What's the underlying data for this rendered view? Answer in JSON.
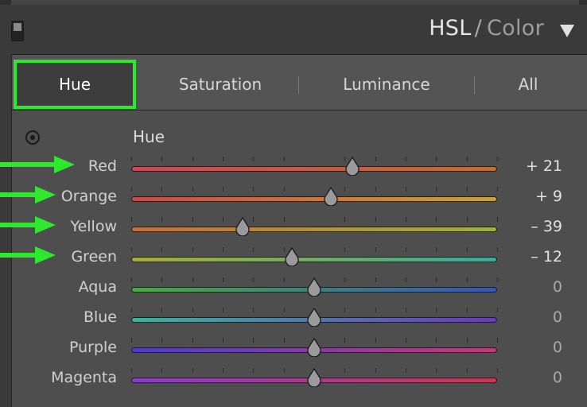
{
  "header": {
    "title_primary": "HSL",
    "title_separator": "/",
    "title_secondary": "Color"
  },
  "tabs": [
    {
      "label": "Hue",
      "active": true
    },
    {
      "label": "Saturation",
      "active": false
    },
    {
      "label": "Luminance",
      "active": false
    },
    {
      "label": "All",
      "active": false
    }
  ],
  "section_label": "Hue",
  "sliders": [
    {
      "label": "Red",
      "value": 21,
      "display": "+ 21",
      "gradient": [
        "#c74a58",
        "#bf6e3a"
      ],
      "highlighted": true
    },
    {
      "label": "Orange",
      "value": 9,
      "display": "+ 9",
      "gradient": [
        "#c64a4a",
        "#c9a337"
      ],
      "highlighted": true
    },
    {
      "label": "Yellow",
      "value": -39,
      "display": "– 39",
      "gradient": [
        "#c2703a",
        "#9fb13e"
      ],
      "highlighted": true
    },
    {
      "label": "Green",
      "value": -12,
      "display": "– 12",
      "gradient": [
        "#a8ac3a",
        "#3ea89b"
      ],
      "highlighted": true
    },
    {
      "label": "Aqua",
      "value": 0,
      "display": "0",
      "gradient": [
        "#4ea848",
        "#3a55b0"
      ],
      "highlighted": false
    },
    {
      "label": "Blue",
      "value": 0,
      "display": "0",
      "gradient": [
        "#3eb09a",
        "#6a3ab8"
      ],
      "highlighted": false
    },
    {
      "label": "Purple",
      "value": 0,
      "display": "0",
      "gradient": [
        "#4a3fc8",
        "#c23a78"
      ],
      "highlighted": false
    },
    {
      "label": "Magenta",
      "value": 0,
      "display": "0",
      "gradient": [
        "#8a3ec6",
        "#c63a52"
      ],
      "highlighted": false
    }
  ],
  "slider_range": [
    -100,
    100
  ],
  "colors": {
    "highlight": "#2ee82e",
    "panel_bg": "#4e4e4e",
    "header_bg": "#3a3a3a"
  },
  "icons": {
    "panel_switch": "panel-toggle-icon",
    "collapse": "triangle-down-icon",
    "target": "targeted-adjustment-icon",
    "slider_thumb": "slider-thumb-icon",
    "annotation": "arrow-right-icon"
  }
}
